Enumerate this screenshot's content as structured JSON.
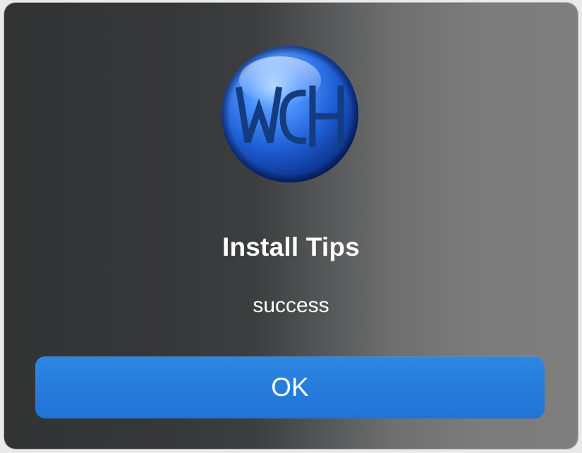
{
  "dialog": {
    "logo": {
      "icon": "wch-logo-icon",
      "monogram": "WCH",
      "colors": {
        "orb_light": "#7fb8ff",
        "orb_mid": "#2a6fe0",
        "orb_dark": "#0b2f8c",
        "letters": "#123a7a"
      }
    },
    "title": "Install Tips",
    "message": "success",
    "ok_button": {
      "label": "OK",
      "color": "#1f73d6"
    }
  }
}
